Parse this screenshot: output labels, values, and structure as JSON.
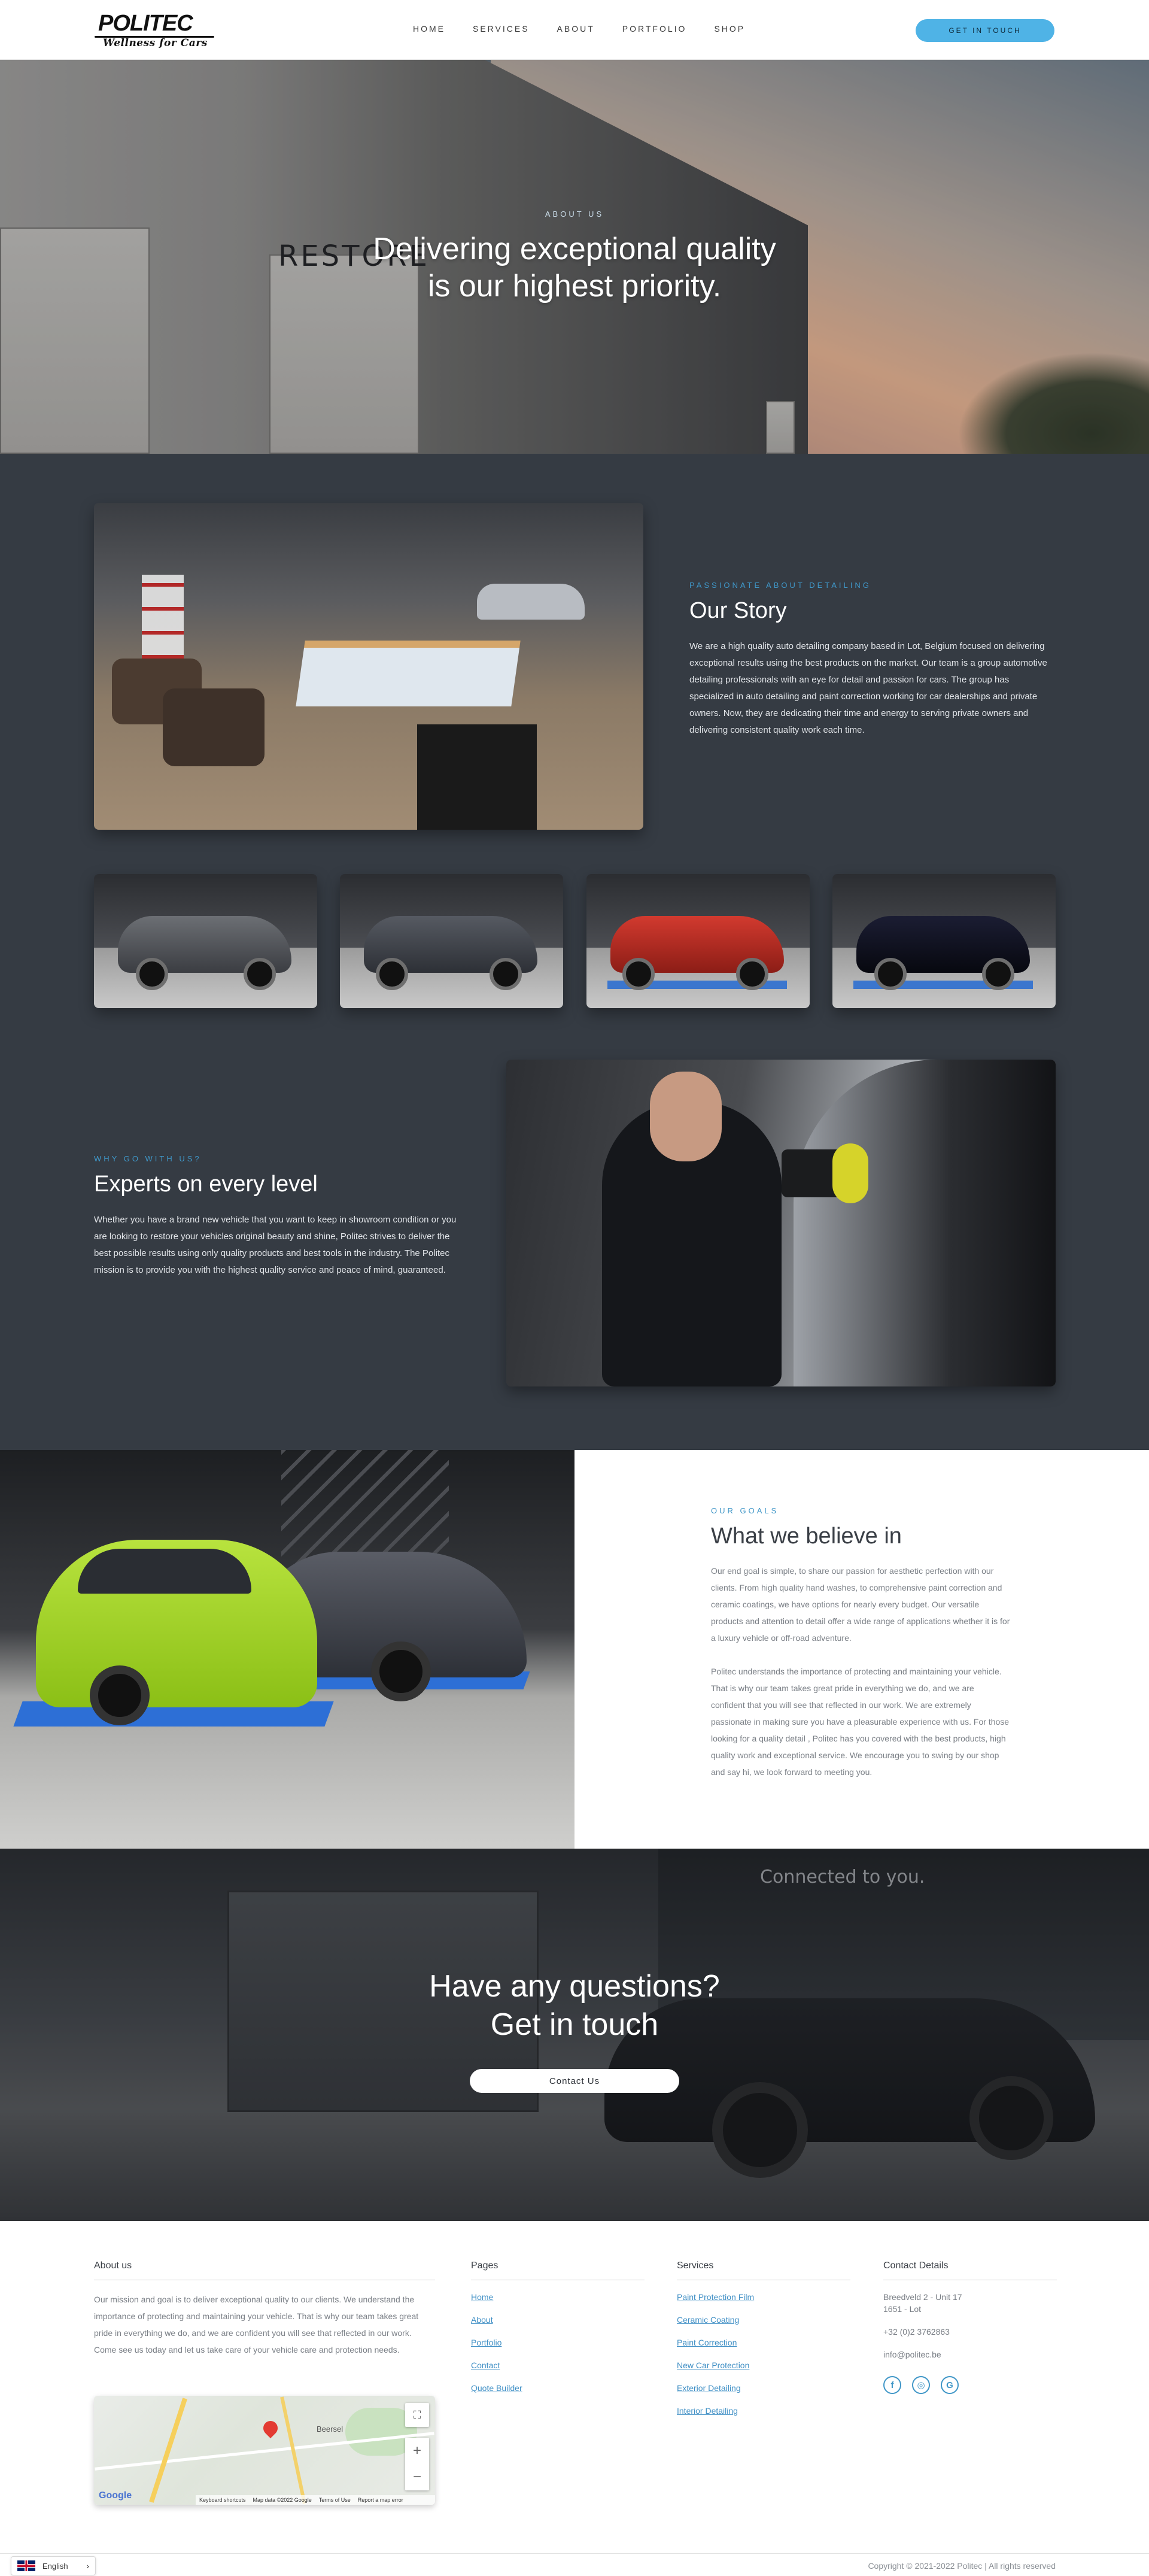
{
  "header": {
    "logo_main": "POLITEC",
    "logo_sub": "Wellness for Cars",
    "nav": [
      "HOME",
      "SERVICES",
      "ABOUT",
      "PORTFOLIO",
      "SHOP"
    ],
    "cta": "GET IN TOUCH",
    "accent_color": "#4fb3e6"
  },
  "hero": {
    "eyebrow": "ABOUT US",
    "title_line1": "Delivering exceptional quality",
    "title_line2": "is our highest priority.",
    "building_sign": "RESTORE"
  },
  "story": {
    "eyebrow": "PASSIONATE ABOUT DETAILING",
    "title": "Our Story",
    "body": "We are a high quality auto detailing company based in Lot, Belgium focused on delivering exceptional results using the best products on the market. Our team is a group automotive detailing professionals with an eye for detail and passion for cars. The group has specialized in auto detailing and paint correction working for car dealerships and private owners. Now, they are dedicating their time and energy to serving private owners and delivering consistent quality work each time."
  },
  "experts": {
    "eyebrow": "WHY GO WITH US?",
    "title": "Experts on every level",
    "body": "Whether you have a brand new vehicle that you want to keep in showroom condition or you are looking to restore your vehicles original beauty and shine, Politec strives to deliver the best possible results using only quality products and best tools in the industry. The Politec mission is to provide you with the highest quality service and peace of mind, guaranteed."
  },
  "beliefs": {
    "eyebrow": "OUR GOALS",
    "title": "What we believe in",
    "body1": "Our end goal is simple, to share our passion for aesthetic perfection with our clients. From high quality hand washes, to comprehensive paint correction and ceramic coatings, we have options for nearly every budget. Our versatile products and attention to detail offer a wide range of applications whether it is for a luxury vehicle or off-road adventure.",
    "body2": "Politec understands the importance of protecting and maintaining your vehicle. That is why our team takes great pride in everything we do, and we are confident that you will see that reflected in our work. We are extremely passionate in making sure you have a pleasurable experience with us. For those looking for a quality detail , Politec has you covered with the best products, high quality work and exceptional service. We encourage you to swing by our shop and say hi, we look forward to meeting you."
  },
  "contact_banner": {
    "title_line1": "Have any questions?",
    "title_line2": "Get in touch",
    "button": "Contact Us",
    "background_text": "Connected to you."
  },
  "footer": {
    "about_title": "About us",
    "about_text": "Our mission and goal is to deliver exceptional quality to our clients. We understand the importance of protecting and maintaining your vehicle. That is why our team takes great pride in everything we do, and we are confident you will see that reflected in our work. Come see us today and let us take care of your vehicle care and protection needs.",
    "pages_title": "Pages",
    "pages": [
      "Home",
      "About",
      "Portfolio",
      "Contact",
      "Quote Builder"
    ],
    "services_title": "Services",
    "services": [
      "Paint Protection Film",
      "Ceramic Coating",
      "Paint Correction",
      "New Car Protection",
      "Exterior Detailing",
      "Interior Detailing"
    ],
    "contact_title": "Contact Details",
    "address_line1": "Breedveld 2 - Unit 17",
    "address_line2": "1651 - Lot",
    "phone": "+32 (0)2 3762863",
    "email": "info@politec.be",
    "socials": [
      {
        "icon": "facebook-icon",
        "glyph": "f"
      },
      {
        "icon": "instagram-icon",
        "glyph": "◎"
      },
      {
        "icon": "google-icon",
        "glyph": "G"
      }
    ],
    "map": {
      "place_label": "Beersel",
      "brand": "Google",
      "attribution": [
        "Keyboard shortcuts",
        "Map data ©2022 Google",
        "Terms of Use",
        "Report a map error"
      ]
    },
    "language": "English",
    "copyright": "Copyright © 2021-2022 Politec | All rights reserved"
  }
}
